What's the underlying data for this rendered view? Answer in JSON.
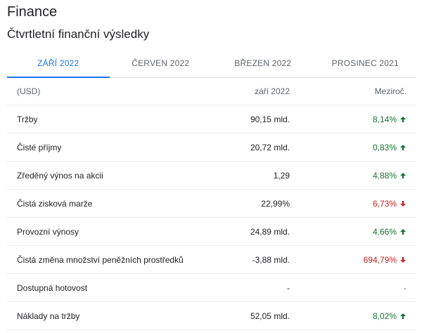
{
  "app": {
    "title": "Finance"
  },
  "section": {
    "title": "Čtvrtletní finanční výsledky"
  },
  "tabs": [
    {
      "label": "ZÁŘÍ 2022",
      "active": true
    },
    {
      "label": "ČERVEN 2022",
      "active": false
    },
    {
      "label": "BŘEZEN 2022",
      "active": false
    },
    {
      "label": "PROSINEC 2021",
      "active": false
    }
  ],
  "table": {
    "header": {
      "label": "(USD)",
      "value": "září 2022",
      "change": "Meziroč."
    },
    "rows": [
      {
        "label": "Tržby",
        "value": "90,15 mld.",
        "change": "8,14%",
        "trend": "up"
      },
      {
        "label": "Čisté příjmy",
        "value": "20,72 mld.",
        "change": "0,83%",
        "trend": "up"
      },
      {
        "label": "Zředěný výnos na akcii",
        "value": "1,29",
        "change": "4,88%",
        "trend": "up"
      },
      {
        "label": "Čistá zisková marže",
        "value": "22,99%",
        "change": "6,73%",
        "trend": "down"
      },
      {
        "label": "Provozní výnosy",
        "value": "24,89 mld.",
        "change": "4,66%",
        "trend": "up"
      },
      {
        "label": "Čistá změna množství peněžních prostředků",
        "value": "-3,88 mld.",
        "change": "694,79%",
        "trend": "down"
      },
      {
        "label": "Dostupná hotovost",
        "value": "-",
        "change": "-",
        "trend": "none"
      },
      {
        "label": "Náklady na tržby",
        "value": "52,05 mld.",
        "change": "8,02%",
        "trend": "up"
      }
    ]
  },
  "colors": {
    "accent": "#1a73e8",
    "up": "#137333",
    "down": "#c5221f"
  }
}
